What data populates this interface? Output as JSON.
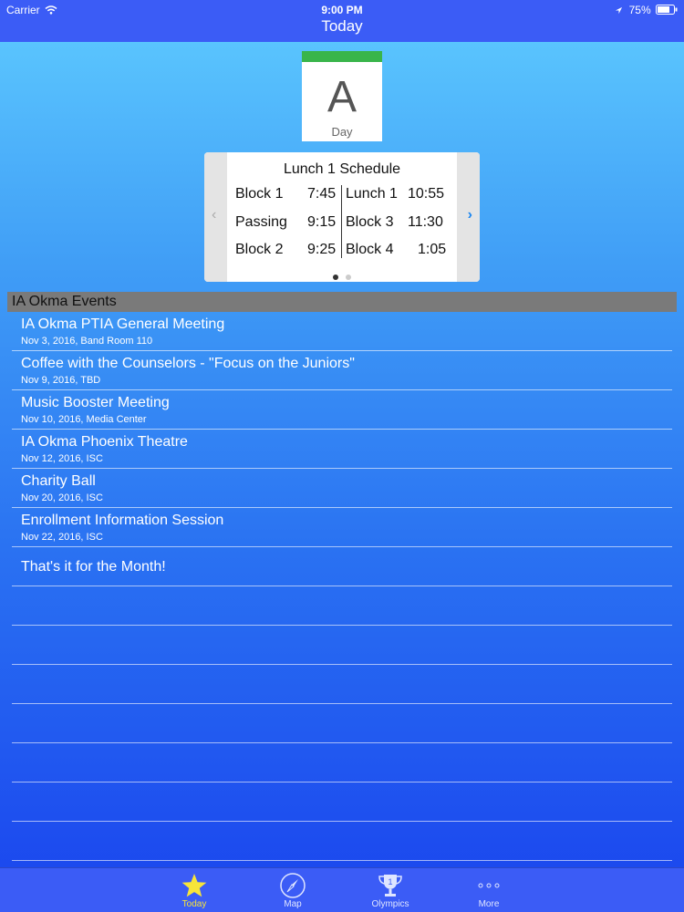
{
  "status": {
    "carrier": "Carrier",
    "time": "9:00 PM",
    "battery": "75%"
  },
  "nav": {
    "title": "Today"
  },
  "day_card": {
    "letter": "A",
    "label": "Day",
    "accent": "#39b54a"
  },
  "schedule": {
    "title": "Lunch 1 Schedule",
    "left": [
      {
        "name": "Block 1",
        "time": "7:45"
      },
      {
        "name": "Passing",
        "time": "9:15"
      },
      {
        "name": "Block 2",
        "time": "9:25"
      }
    ],
    "right": [
      {
        "name": "Lunch 1",
        "time": "10:55"
      },
      {
        "name": "Block 3",
        "time": "11:30"
      },
      {
        "name": "Block 4",
        "time": "1:05"
      }
    ],
    "prev_icon": "chevron-left-icon",
    "next_icon": "chevron-right-icon",
    "page_index": 1,
    "page_count": 2
  },
  "events": {
    "header": "IA Okma Events",
    "items": [
      {
        "title": "IA Okma PTIA General Meeting",
        "sub": "Nov 3, 2016, Band Room 110"
      },
      {
        "title": "Coffee with the Counselors - \"Focus on the Juniors\"",
        "sub": "Nov 9, 2016, TBD"
      },
      {
        "title": "Music Booster Meeting",
        "sub": "Nov 10, 2016, Media Center"
      },
      {
        "title": "IA Okma Phoenix Theatre",
        "sub": "Nov 12, 2016, ISC"
      },
      {
        "title": "Charity Ball",
        "sub": "Nov 20, 2016, ISC"
      },
      {
        "title": "Enrollment Information Session",
        "sub": "Nov 22, 2016, ISC"
      }
    ],
    "end_text": "That's it for the Month!"
  },
  "tabs": [
    {
      "label": "Today",
      "icon": "star-icon",
      "active": true
    },
    {
      "label": "Map",
      "icon": "compass-icon",
      "active": false
    },
    {
      "label": "Olympics",
      "icon": "trophy-icon",
      "active": false
    },
    {
      "label": "More",
      "icon": "more-icon",
      "active": false
    }
  ],
  "colors": {
    "bar": "#3b5cf6",
    "active_tab": "#f7e43a",
    "next_arrow": "#1a86f0"
  }
}
